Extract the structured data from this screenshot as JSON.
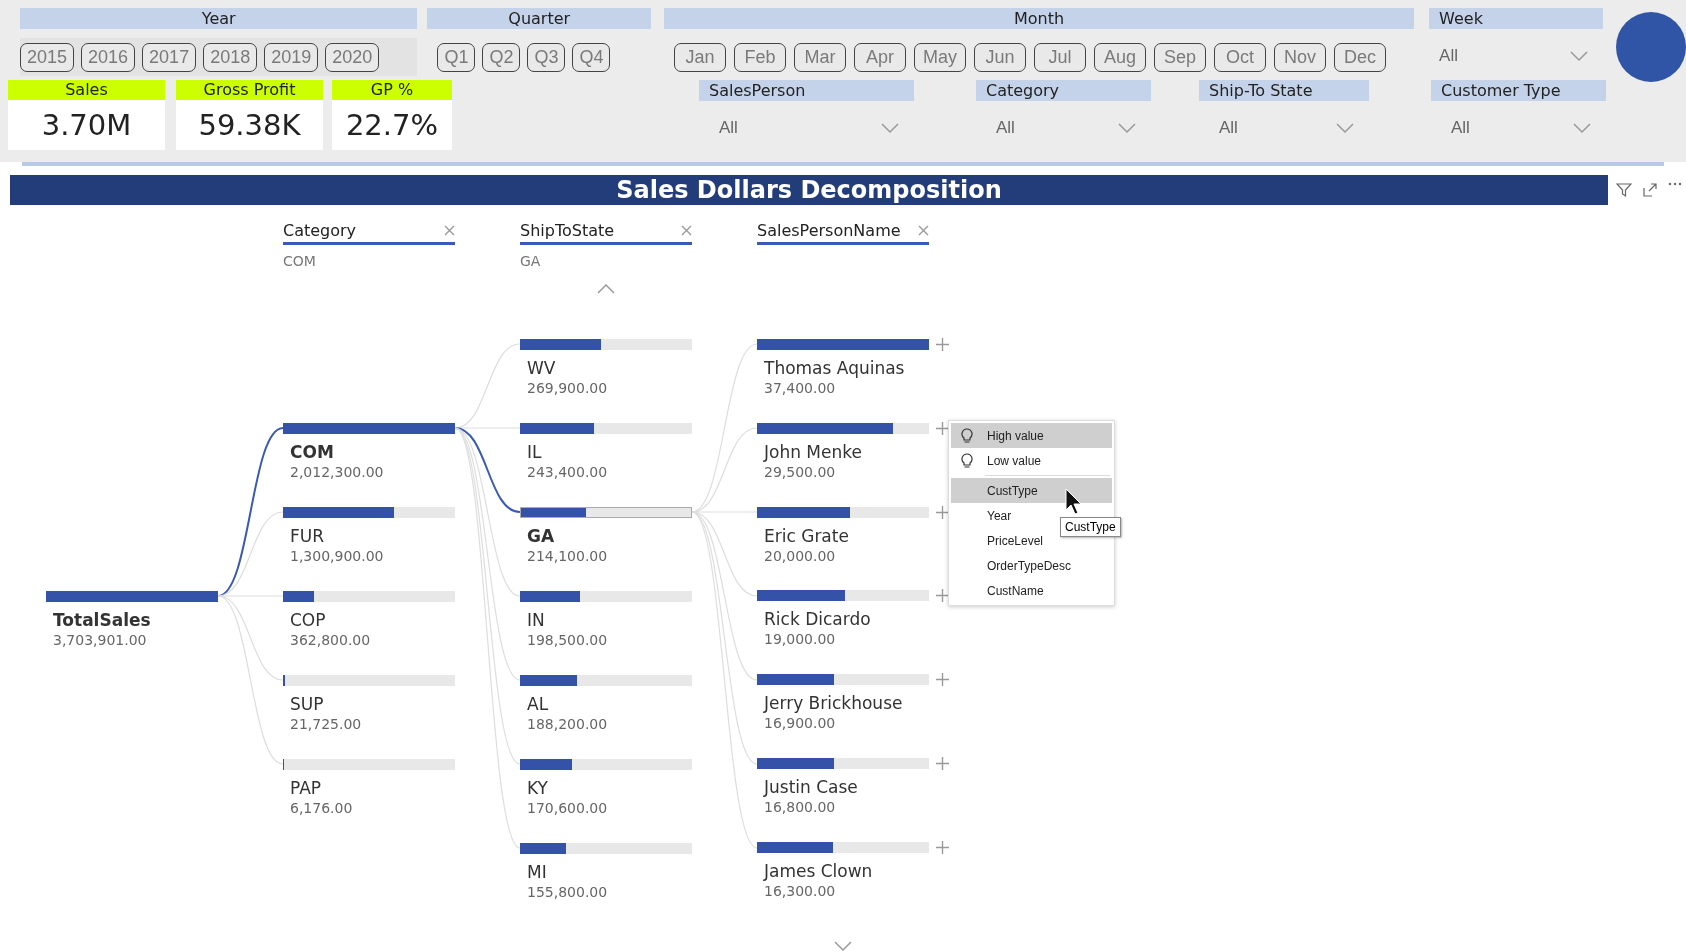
{
  "filters": {
    "year": {
      "title": "Year",
      "buttons": [
        {
          "label": "2015",
          "selected": false
        },
        {
          "label": "2016",
          "selected": false
        },
        {
          "label": "2017",
          "selected": false
        },
        {
          "label": "2018",
          "selected": false
        },
        {
          "label": "2019",
          "selected": false
        },
        {
          "label": "2020",
          "selected": false
        }
      ]
    },
    "quarter": {
      "title": "Quarter",
      "buttons": [
        {
          "label": "Q1",
          "selected": false
        },
        {
          "label": "Q2",
          "selected": false
        },
        {
          "label": "Q3",
          "selected": false
        },
        {
          "label": "Q4",
          "selected": false
        }
      ]
    },
    "month": {
      "title": "Month",
      "buttons": [
        {
          "label": "Jan",
          "selected": false
        },
        {
          "label": "Feb",
          "selected": false
        },
        {
          "label": "Mar",
          "selected": false
        },
        {
          "label": "Apr",
          "selected": false
        },
        {
          "label": "May",
          "selected": false
        },
        {
          "label": "Jun",
          "selected": false
        },
        {
          "label": "Jul",
          "selected": false
        },
        {
          "label": "Aug",
          "selected": false
        },
        {
          "label": "Sep",
          "selected": false
        },
        {
          "label": "Oct",
          "selected": false
        },
        {
          "label": "Nov",
          "selected": false
        },
        {
          "label": "Dec",
          "selected": false
        }
      ]
    },
    "week": {
      "title": "Week",
      "value": "All"
    }
  },
  "kpis": [
    {
      "label": "Sales",
      "value": "3.70M"
    },
    {
      "label": "Gross Profit",
      "value": "59.38K"
    },
    {
      "label": "GP %",
      "value": "22.7%"
    }
  ],
  "slicers": [
    {
      "title": "SalesPerson",
      "value": "All"
    },
    {
      "title": "Category",
      "value": "All"
    },
    {
      "title": "Ship-To State",
      "value": "All"
    },
    {
      "title": "Customer Type",
      "value": "All"
    }
  ],
  "visual": {
    "title": "Sales Dollars Decomposition",
    "root": {
      "name": "TotalSales",
      "value": "3,703,901.00",
      "level": 1
    },
    "levels": [
      {
        "field": "Category",
        "filter": "COM",
        "more_above": false,
        "more_below": false,
        "nodes": [
          {
            "name": "COM",
            "value": "2,012,300.00",
            "level": 1,
            "selected": true,
            "expandable": false
          },
          {
            "name": "FUR",
            "value": "1,300,900.00",
            "level": 0.646,
            "selected": false,
            "expandable": false
          },
          {
            "name": "COP",
            "value": "362,800.00",
            "level": 0.18,
            "selected": false,
            "expandable": false
          },
          {
            "name": "SUP",
            "value": "21,725.00",
            "level": 0.011,
            "selected": false,
            "expandable": false
          },
          {
            "name": "PAP",
            "value": "6,176.00",
            "level": 0.004,
            "selected": false,
            "expandable": false
          }
        ]
      },
      {
        "field": "ShipToState",
        "filter": "GA",
        "more_above": true,
        "more_below": false,
        "nodes": [
          {
            "name": "WV",
            "value": "269,900.00",
            "level": 0.47,
            "selected": false,
            "expandable": false
          },
          {
            "name": "IL",
            "value": "243,400.00",
            "level": 0.43,
            "selected": false,
            "expandable": false
          },
          {
            "name": "GA",
            "value": "214,100.00",
            "level": 0.38,
            "selected": true,
            "expandable": false
          },
          {
            "name": "IN",
            "value": "198,500.00",
            "level": 0.35,
            "selected": false,
            "expandable": false
          },
          {
            "name": "AL",
            "value": "188,200.00",
            "level": 0.33,
            "selected": false,
            "expandable": false
          },
          {
            "name": "KY",
            "value": "170,600.00",
            "level": 0.3,
            "selected": false,
            "expandable": false
          },
          {
            "name": "MI",
            "value": "155,800.00",
            "level": 0.27,
            "selected": false,
            "expandable": false
          }
        ]
      },
      {
        "field": "SalesPersonName",
        "more_above": false,
        "more_below": true,
        "nodes": [
          {
            "name": "Thomas Aquinas",
            "value": "37,400.00",
            "level": 1,
            "selected": false,
            "expandable": true
          },
          {
            "name": "John Menke",
            "value": "29,500.00",
            "level": 0.79,
            "selected": false,
            "expandable": true
          },
          {
            "name": "Eric Grate",
            "value": "20,000.00",
            "level": 0.54,
            "selected": false,
            "expandable": true
          },
          {
            "name": "Rick Dicardo",
            "value": "19,000.00",
            "level": 0.51,
            "selected": false,
            "expandable": true
          },
          {
            "name": "Jerry Brickhouse",
            "value": "16,900.00",
            "level": 0.45,
            "selected": false,
            "expandable": true
          },
          {
            "name": "Justin Case",
            "value": "16,800.00",
            "level": 0.45,
            "selected": false,
            "expandable": true
          },
          {
            "name": "James Clown",
            "value": "16,300.00",
            "level": 0.44,
            "selected": false,
            "expandable": true
          }
        ]
      }
    ],
    "menu": {
      "items": [
        {
          "kind": "insight",
          "label": "High value",
          "selected": true
        },
        {
          "kind": "insight",
          "label": "Low value",
          "selected": false
        },
        {
          "kind": "field",
          "label": "CustType",
          "selected": true
        },
        {
          "kind": "field",
          "label": "Year",
          "selected": false
        },
        {
          "kind": "field",
          "label": "PriceLevel",
          "selected": false
        },
        {
          "kind": "field",
          "label": "OrderTypeDesc",
          "selected": false
        },
        {
          "kind": "field",
          "label": "CustName",
          "selected": false
        }
      ],
      "tooltip": "CustType"
    }
  }
}
